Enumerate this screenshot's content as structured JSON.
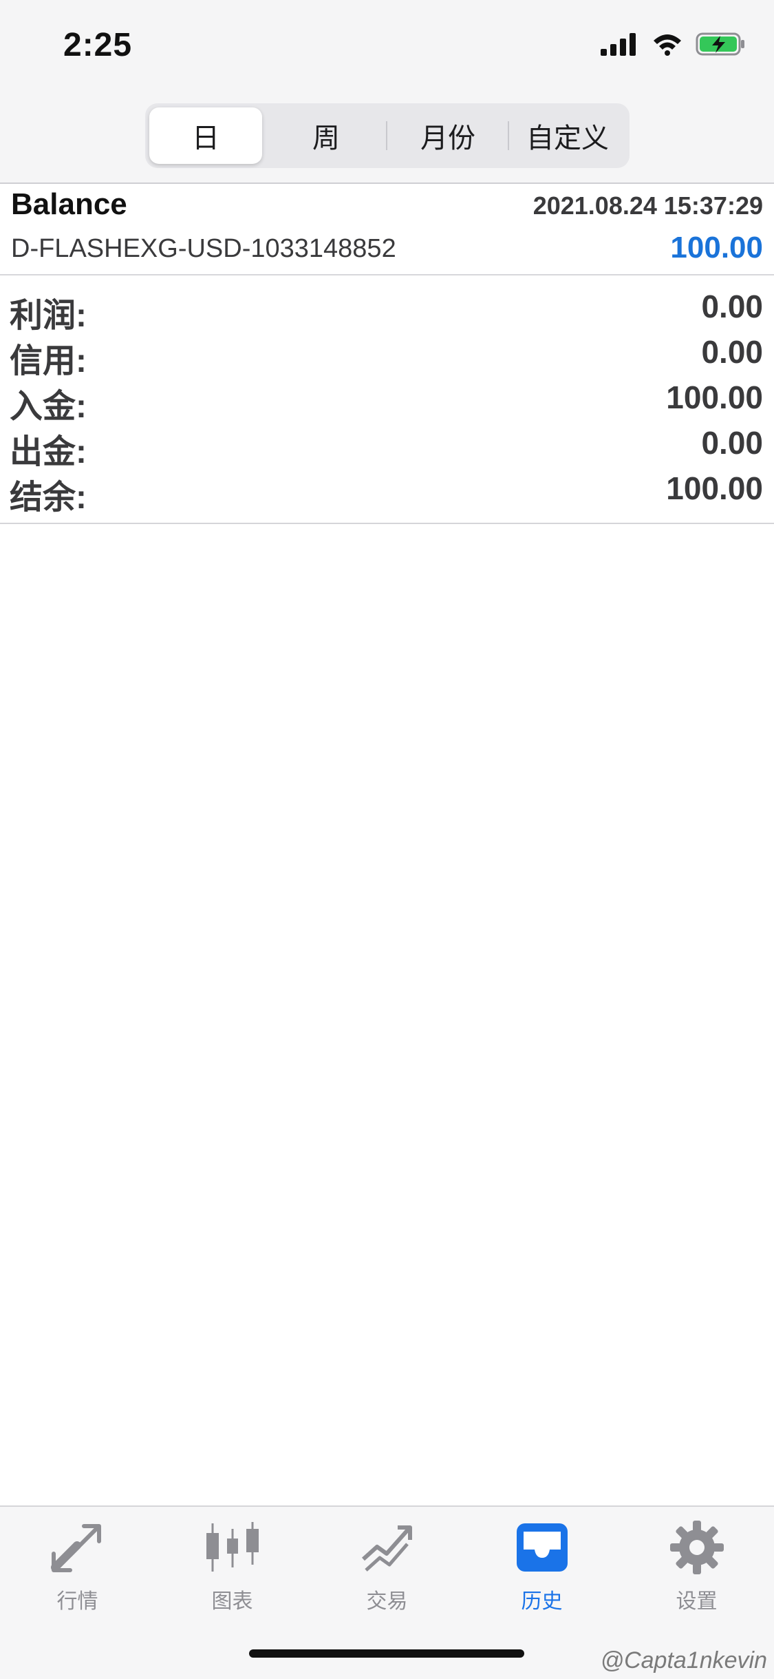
{
  "status_bar": {
    "time": "2:25",
    "icons": [
      "signal-icon",
      "wifi-icon",
      "battery-charging-icon"
    ]
  },
  "segments": {
    "items": [
      "日",
      "周",
      "月份",
      "自定义"
    ],
    "active_index": 0
  },
  "record": {
    "title": "Balance",
    "datetime": "2021.08.24 15:37:29",
    "account": "D-FLASHEXG-USD-1033148852",
    "amount": "100.00",
    "amount_color": "#1a73d9",
    "details": [
      {
        "label": "利润:",
        "value": "0.00"
      },
      {
        "label": "信用:",
        "value": "0.00"
      },
      {
        "label": "入金:",
        "value": "100.00"
      },
      {
        "label": "出金:",
        "value": "0.00"
      },
      {
        "label": "结余:",
        "value": "100.00"
      }
    ]
  },
  "tabbar": {
    "tabs": [
      {
        "label": "行情",
        "icon": "quotes-arrows-icon"
      },
      {
        "label": "图表",
        "icon": "candlestick-chart-icon"
      },
      {
        "label": "交易",
        "icon": "trade-trend-icon"
      },
      {
        "label": "历史",
        "icon": "inbox-tray-icon"
      },
      {
        "label": "设置",
        "icon": "gear-icon"
      }
    ],
    "active_index": 3,
    "active_color": "#1a73e8",
    "inactive_color": "#8e8e93"
  },
  "watermark": "@Capta1nkevin"
}
